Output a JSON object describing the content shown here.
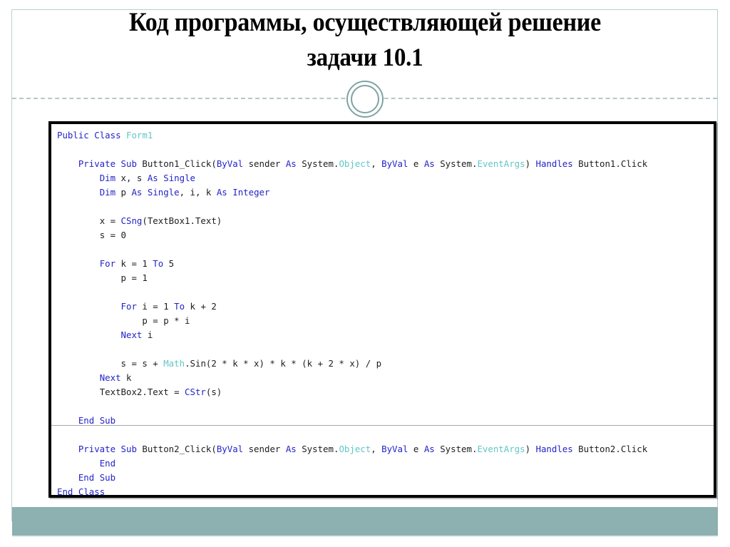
{
  "slide": {
    "title_line_1": "Код программы, осуществляющей решение",
    "title_line_2": "задачи 10.1",
    "accent_color": "#8db0b0",
    "frame_color": "#b9cfcf",
    "divider_color": "#9bb6b6"
  },
  "code_panel": {
    "language": "Visual Basic .NET",
    "border_color": "#000000",
    "separator_color": "#a8a8a8",
    "syntax_colors": {
      "keyword": "#2323c8",
      "type": "#63c6c6",
      "plain": "#1d1d1d"
    },
    "lines": [
      {
        "indent": 0,
        "tokens": [
          {
            "t": "Public",
            "c": "kw"
          },
          {
            "t": " ",
            "c": "pln"
          },
          {
            "t": "Class",
            "c": "kw"
          },
          {
            "t": " ",
            "c": "pln"
          },
          {
            "t": "Form1",
            "c": "typ"
          }
        ]
      },
      {
        "indent": 0,
        "tokens": []
      },
      {
        "indent": 4,
        "tokens": [
          {
            "t": "Private",
            "c": "kw"
          },
          {
            "t": " ",
            "c": "pln"
          },
          {
            "t": "Sub",
            "c": "kw"
          },
          {
            "t": " Button1_Click(",
            "c": "pln"
          },
          {
            "t": "ByVal",
            "c": "kw"
          },
          {
            "t": " sender ",
            "c": "pln"
          },
          {
            "t": "As",
            "c": "kw"
          },
          {
            "t": " System.",
            "c": "pln"
          },
          {
            "t": "Object",
            "c": "typ"
          },
          {
            "t": ", ",
            "c": "pln"
          },
          {
            "t": "ByVal",
            "c": "kw"
          },
          {
            "t": " e ",
            "c": "pln"
          },
          {
            "t": "As",
            "c": "kw"
          },
          {
            "t": " System.",
            "c": "pln"
          },
          {
            "t": "EventArgs",
            "c": "typ"
          },
          {
            "t": ") ",
            "c": "pln"
          },
          {
            "t": "Handles",
            "c": "kw"
          },
          {
            "t": " Button1.Click",
            "c": "pln"
          }
        ]
      },
      {
        "indent": 8,
        "tokens": [
          {
            "t": "Dim",
            "c": "kw"
          },
          {
            "t": " x, s ",
            "c": "pln"
          },
          {
            "t": "As",
            "c": "kw"
          },
          {
            "t": " ",
            "c": "pln"
          },
          {
            "t": "Single",
            "c": "kw"
          }
        ]
      },
      {
        "indent": 8,
        "tokens": [
          {
            "t": "Dim",
            "c": "kw"
          },
          {
            "t": " p ",
            "c": "pln"
          },
          {
            "t": "As",
            "c": "kw"
          },
          {
            "t": " ",
            "c": "pln"
          },
          {
            "t": "Single",
            "c": "kw"
          },
          {
            "t": ", i, k ",
            "c": "pln"
          },
          {
            "t": "As",
            "c": "kw"
          },
          {
            "t": " ",
            "c": "pln"
          },
          {
            "t": "Integer",
            "c": "kw"
          }
        ]
      },
      {
        "indent": 0,
        "tokens": []
      },
      {
        "indent": 8,
        "tokens": [
          {
            "t": "x = ",
            "c": "pln"
          },
          {
            "t": "CSng",
            "c": "kw"
          },
          {
            "t": "(TextBox1.Text)",
            "c": "pln"
          }
        ]
      },
      {
        "indent": 8,
        "tokens": [
          {
            "t": "s = 0",
            "c": "pln"
          }
        ]
      },
      {
        "indent": 0,
        "tokens": []
      },
      {
        "indent": 8,
        "tokens": [
          {
            "t": "For",
            "c": "kw"
          },
          {
            "t": " k = 1 ",
            "c": "pln"
          },
          {
            "t": "To",
            "c": "kw"
          },
          {
            "t": " 5",
            "c": "pln"
          }
        ]
      },
      {
        "indent": 12,
        "tokens": [
          {
            "t": "p = 1",
            "c": "pln"
          }
        ]
      },
      {
        "indent": 0,
        "tokens": []
      },
      {
        "indent": 12,
        "tokens": [
          {
            "t": "For",
            "c": "kw"
          },
          {
            "t": " i = 1 ",
            "c": "pln"
          },
          {
            "t": "To",
            "c": "kw"
          },
          {
            "t": " k + 2",
            "c": "pln"
          }
        ]
      },
      {
        "indent": 16,
        "tokens": [
          {
            "t": "p = p * i",
            "c": "pln"
          }
        ]
      },
      {
        "indent": 12,
        "tokens": [
          {
            "t": "Next",
            "c": "kw"
          },
          {
            "t": " i",
            "c": "pln"
          }
        ]
      },
      {
        "indent": 0,
        "tokens": []
      },
      {
        "indent": 12,
        "tokens": [
          {
            "t": "s = s + ",
            "c": "pln"
          },
          {
            "t": "Math",
            "c": "typ"
          },
          {
            "t": ".Sin(2 * k * x) * k * (k + 2 * x) / p",
            "c": "pln"
          }
        ]
      },
      {
        "indent": 8,
        "tokens": [
          {
            "t": "Next",
            "c": "kw"
          },
          {
            "t": " k",
            "c": "pln"
          }
        ]
      },
      {
        "indent": 8,
        "tokens": [
          {
            "t": "TextBox2.Text = ",
            "c": "pln"
          },
          {
            "t": "CStr",
            "c": "kw"
          },
          {
            "t": "(s)",
            "c": "pln"
          }
        ]
      },
      {
        "indent": 0,
        "tokens": []
      },
      {
        "indent": 4,
        "tokens": [
          {
            "t": "End",
            "c": "kw"
          },
          {
            "t": " ",
            "c": "pln"
          },
          {
            "t": "Sub",
            "c": "kw"
          }
        ]
      },
      {
        "indent": 0,
        "tokens": []
      },
      {
        "indent": 4,
        "tokens": [
          {
            "t": "Private",
            "c": "kw"
          },
          {
            "t": " ",
            "c": "pln"
          },
          {
            "t": "Sub",
            "c": "kw"
          },
          {
            "t": " Button2_Click(",
            "c": "pln"
          },
          {
            "t": "ByVal",
            "c": "kw"
          },
          {
            "t": " sender ",
            "c": "pln"
          },
          {
            "t": "As",
            "c": "kw"
          },
          {
            "t": " System.",
            "c": "pln"
          },
          {
            "t": "Object",
            "c": "typ"
          },
          {
            "t": ", ",
            "c": "pln"
          },
          {
            "t": "ByVal",
            "c": "kw"
          },
          {
            "t": " e ",
            "c": "pln"
          },
          {
            "t": "As",
            "c": "kw"
          },
          {
            "t": " System.",
            "c": "pln"
          },
          {
            "t": "EventArgs",
            "c": "typ"
          },
          {
            "t": ") ",
            "c": "pln"
          },
          {
            "t": "Handles",
            "c": "kw"
          },
          {
            "t": " Button2.Click",
            "c": "pln"
          }
        ]
      },
      {
        "indent": 8,
        "tokens": [
          {
            "t": "End",
            "c": "kw"
          }
        ]
      },
      {
        "indent": 4,
        "tokens": [
          {
            "t": "End",
            "c": "kw"
          },
          {
            "t": " ",
            "c": "pln"
          },
          {
            "t": "Sub",
            "c": "kw"
          }
        ]
      },
      {
        "indent": 0,
        "tokens": [
          {
            "t": "End",
            "c": "kw"
          },
          {
            "t": " ",
            "c": "pln"
          },
          {
            "t": "Class",
            "c": "kw"
          }
        ]
      }
    ],
    "plain_text": "Public Class Form1\n\n    Private Sub Button1_Click(ByVal sender As System.Object, ByVal e As System.EventArgs) Handles Button1.Click\n        Dim x, s As Single\n        Dim p As Single, i, k As Integer\n\n        x = CSng(TextBox1.Text)\n        s = 0\n\n        For k = 1 To 5\n            p = 1\n\n            For i = 1 To k + 2\n                p = p * i\n            Next i\n\n            s = s + Math.Sin(2 * k * x) * k * (k + 2 * x) / p\n        Next k\n        TextBox2.Text = CStr(s)\n\n    End Sub\n\n    Private Sub Button2_Click(ByVal sender As System.Object, ByVal e As System.EventArgs) Handles Button2.Click\n        End\n    End Sub\nEnd Class"
  }
}
